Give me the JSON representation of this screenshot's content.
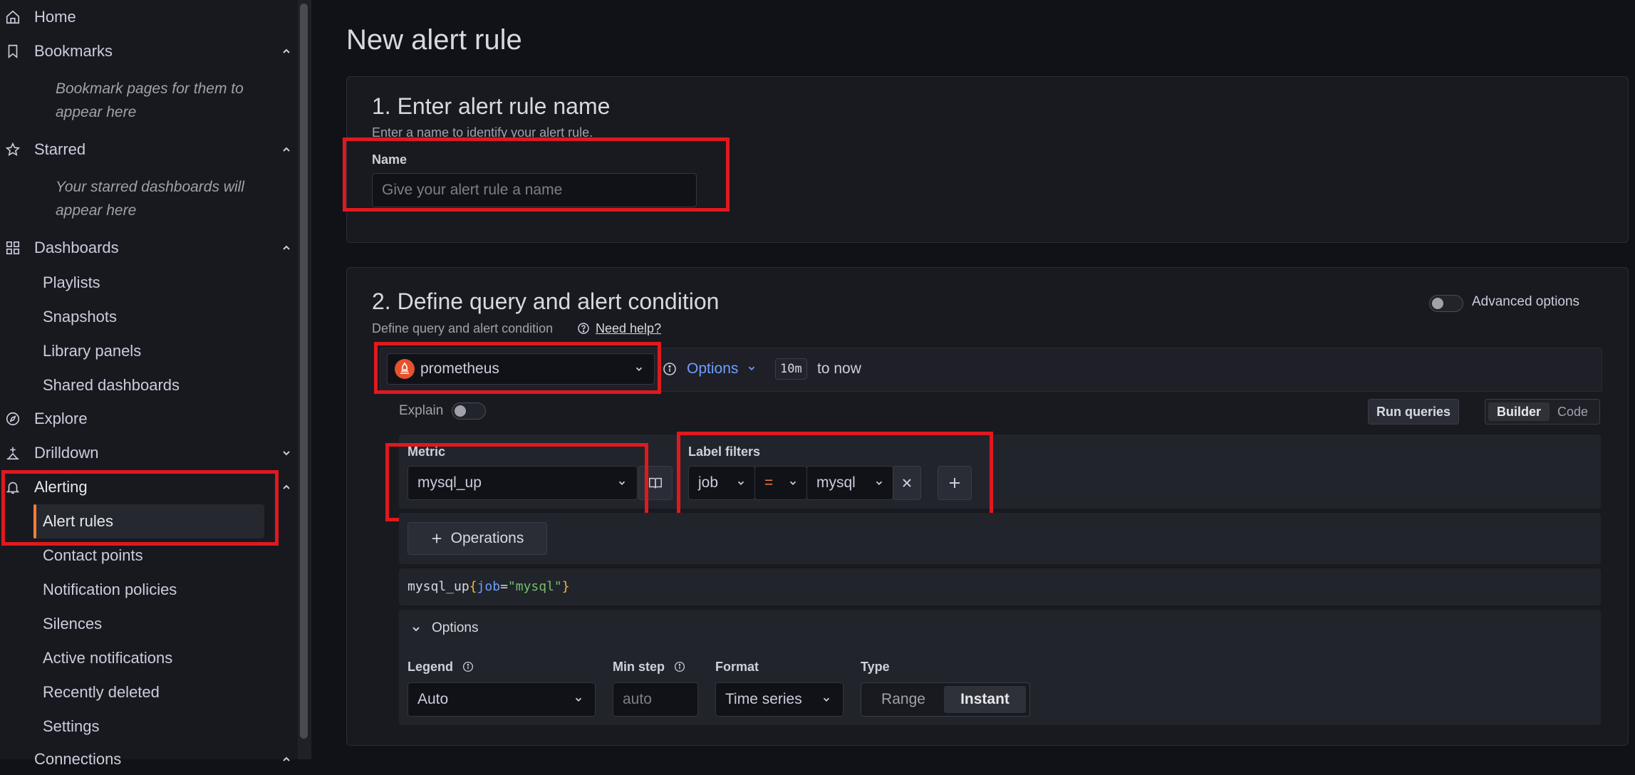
{
  "sidebar": {
    "home": "Home",
    "bookmarks": "Bookmarks",
    "bookmarks_hint_line1": "Bookmark pages for them to",
    "bookmarks_hint_line2": "appear here",
    "starred": "Starred",
    "starred_hint_line1": "Your starred dashboards will",
    "starred_hint_line2": "appear here",
    "dashboards": "Dashboards",
    "dashboards_items": [
      "Playlists",
      "Snapshots",
      "Library panels",
      "Shared dashboards"
    ],
    "explore": "Explore",
    "drilldown": "Drilldown",
    "alerting": "Alerting",
    "alerting_items": [
      "Alert rules",
      "Contact points",
      "Notification policies",
      "Silences",
      "Active notifications",
      "Recently deleted",
      "Settings"
    ],
    "connections": "Connections"
  },
  "page": {
    "title": "New alert rule"
  },
  "section1": {
    "title": "1. Enter alert rule name",
    "subtitle": "Enter a name to identify your alert rule.",
    "name_label": "Name",
    "name_placeholder": "Give your alert rule a name"
  },
  "section2": {
    "title": "2. Define query and alert condition",
    "subtitle": "Define query and alert condition",
    "help_link": "Need help?",
    "advanced_options": "Advanced options",
    "datasource": "prometheus",
    "options_label": "Options",
    "time_range_value": "10m",
    "time_range_suffix": "to now",
    "explain_label": "Explain",
    "run_queries": "Run queries",
    "builder": "Builder",
    "code": "Code",
    "metric_label": "Metric",
    "metric_value": "mysql_up",
    "label_filters_label": "Label filters",
    "filter_key": "job",
    "filter_op": "=",
    "filter_value": "mysql",
    "operations": "Operations",
    "query_preview": {
      "metric": "mysql_up",
      "open": "{",
      "key": "job",
      "eq": "=",
      "val": "\"mysql\"",
      "close": "}"
    },
    "options_section": "Options",
    "legend_label": "Legend",
    "legend_value": "Auto",
    "min_step_label": "Min step",
    "min_step_placeholder": "auto",
    "format_label": "Format",
    "format_value": "Time series",
    "type_label": "Type",
    "type_range": "Range",
    "type_instant": "Instant"
  },
  "colors": {
    "accent": "#f47d3b",
    "highlight": "#e0191e",
    "link": "#6e9fff"
  },
  "icons": [
    "home-icon",
    "bookmark-icon",
    "star-icon",
    "dashboards-icon",
    "explore-icon",
    "drilldown-icon",
    "bell-icon",
    "chevron-up-icon",
    "chevron-down-icon",
    "info-icon",
    "help-icon",
    "book-icon",
    "close-icon",
    "plus-icon",
    "prometheus-icon"
  ]
}
